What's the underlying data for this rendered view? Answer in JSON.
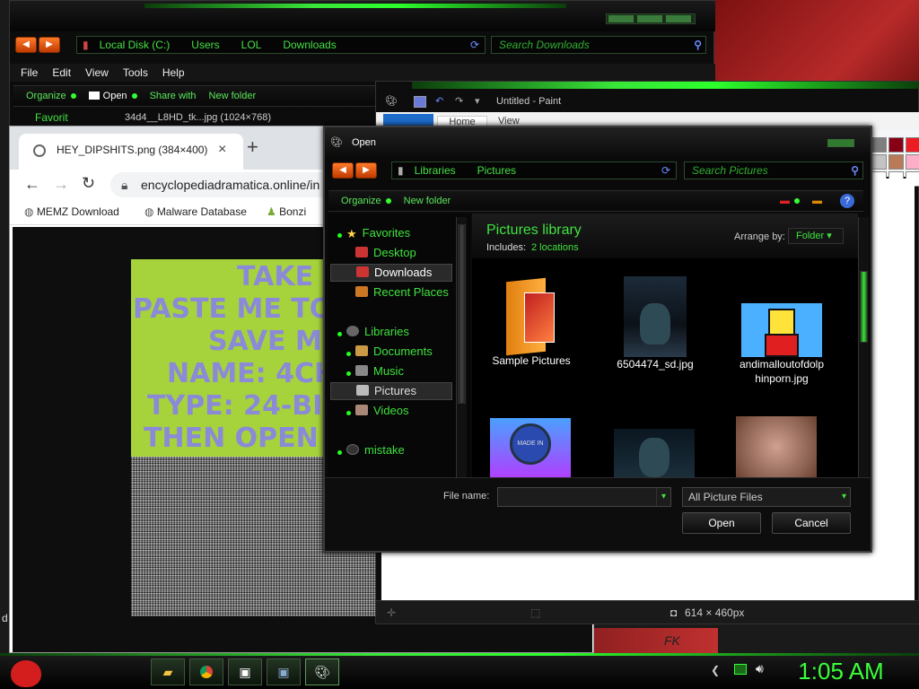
{
  "explorer": {
    "breadcrumb": [
      "Local Disk (C:)",
      "Users",
      "LOL",
      "Downloads"
    ],
    "search_placeholder": "Search Downloads",
    "menu": [
      "File",
      "Edit",
      "View",
      "Tools",
      "Help"
    ],
    "commands": {
      "organize": "Organize",
      "open": "Open",
      "share": "Share with",
      "new_folder": "New folder"
    },
    "nav_partial": "Favorit",
    "file_partial": "34d4__L8HD_tk...jpg  (1024×768)"
  },
  "chrome": {
    "tab_title": "HEY_DIPSHITS.png (384×400)",
    "tab_close": "×",
    "new_tab": "+",
    "url": "encyclopediadramatica.online/in",
    "bookmarks": [
      "MEMZ Download",
      "Malware Database",
      "Bonzi"
    ],
    "image_lines": [
      "TAKE",
      "PASTE ME TO",
      "SAVE M",
      "NAME: 4CH",
      "TYPE: 24-BI",
      "THEN OPEN"
    ],
    "left_edge_text": "d"
  },
  "paint": {
    "title": "Untitled - Paint",
    "tabs": [
      "Home",
      "View"
    ],
    "status_size": "614 × 460px"
  },
  "dialog": {
    "title": "Open",
    "breadcrumb": [
      "Libraries",
      "Pictures"
    ],
    "search_placeholder": "Search Pictures",
    "commands": {
      "organize": "Organize",
      "new_folder": "New folder"
    },
    "help": "?",
    "nav": {
      "favorites": "Favorites",
      "desktop": "Desktop",
      "downloads": "Downloads",
      "recent": "Recent Places",
      "libraries": "Libraries",
      "documents": "Documents",
      "music": "Music",
      "pictures": "Pictures",
      "videos": "Videos",
      "mistake": "mistake"
    },
    "library_title": "Pictures library",
    "includes_label": "Includes:",
    "includes_value": "2 locations",
    "arrange_label": "Arrange by:",
    "arrange_value": "Folder",
    "files": [
      {
        "name": "Sample Pictures"
      },
      {
        "name": "6504474_sd.jpg"
      },
      {
        "name": "andimalloutofdolphinporn.jpg"
      }
    ],
    "bottom_thumb_text": "MADE IN",
    "comic_text": "",
    "file_name_label": "File name:",
    "file_name_value": "",
    "filter_value": "All Picture Files",
    "open_button": "Open",
    "cancel_button": "Cancel"
  },
  "taskbar": {
    "clock": "1:05 AM"
  },
  "background": {
    "red_text": "FK"
  },
  "colors": {
    "accent_green": "#39e639",
    "text_green": "#3fe23f",
    "nav_orange": "#ff7a2a"
  }
}
